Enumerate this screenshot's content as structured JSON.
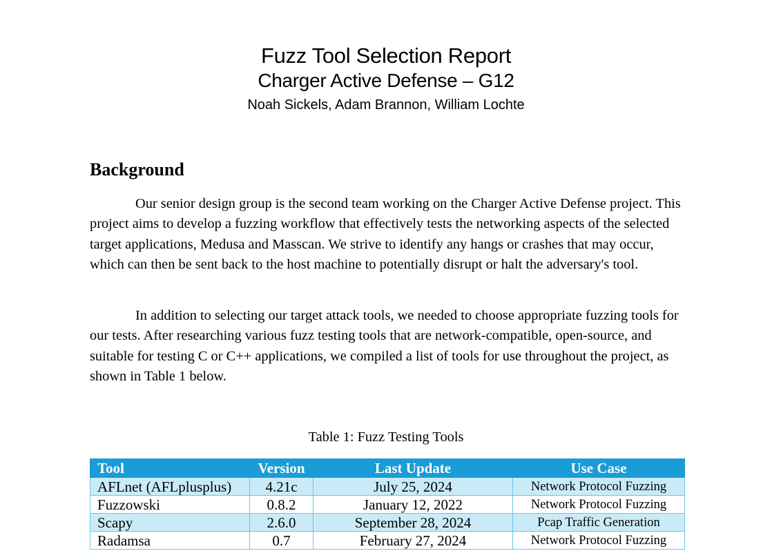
{
  "header": {
    "title": "Fuzz Tool Selection Report",
    "subtitle": "Charger Active Defense – G12",
    "authors": "Noah Sickels, Adam Brannon, William Lochte"
  },
  "background": {
    "heading": "Background",
    "paragraphs": [
      "Our senior design group is the second team working on the Charger Active Defense project. This project aims to develop a fuzzing workflow that effectively tests the networking aspects of the selected target applications, Medusa and Masscan. We strive to identify any hangs or crashes that may occur, which can then be sent back to the host machine to potentially disrupt or halt the adversary's tool.",
      "In addition to selecting our target attack tools, we needed to choose appropriate fuzzing tools for our tests. After researching various fuzz testing tools that are network-compatible, open-source, and suitable for testing C or C++ applications, we compiled a list of tools for use throughout the project, as shown in Table 1 below."
    ]
  },
  "table": {
    "caption": "Table 1: Fuzz Testing Tools",
    "columns": [
      "Tool",
      "Version",
      "Last Update",
      "Use Case"
    ],
    "rows": [
      [
        "AFLnet (AFLplusplus)",
        "4.21c",
        "July 25, 2024",
        "Network Protocol Fuzzing"
      ],
      [
        "Fuzzowski",
        "0.8.2",
        "January 12, 2022",
        "Network Protocol Fuzzing"
      ],
      [
        "Scapy",
        "2.6.0",
        "September 28, 2024",
        "Pcap Traffic Generation"
      ],
      [
        "Radamsa",
        "0.7",
        "February 27, 2024",
        "Network Protocol Fuzzing"
      ]
    ],
    "header_color": "#1a9cd6",
    "shaded_row_color": "#c9ebf8"
  }
}
